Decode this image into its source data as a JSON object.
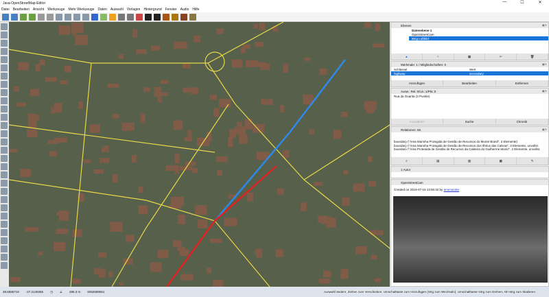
{
  "window": {
    "title": "Java-OpenStreetMap-Editor",
    "controls": [
      "—",
      "☐",
      "✕"
    ]
  },
  "menu": [
    "Datei",
    "Bearbeiten",
    "Ansicht",
    "Werkzeuge",
    "Mehr Werkzeuge",
    "Daten",
    "Auswahl",
    "Vorlagen",
    "Hintergrund",
    "Fenster",
    "Audio",
    "Hilfe"
  ],
  "toolbar_colors": [
    "#4a7fc0",
    "#4a7fc0",
    "#6aa040",
    "#6aa040",
    "#999",
    "#999",
    "#8899aa",
    "#8899aa",
    "#8899aa",
    "#8899aa",
    "#3366cc",
    "#88bb66",
    "#f0a020",
    "#777",
    "#777",
    "#cc4444",
    "#222",
    "#222",
    "#aa5511",
    "#aa7711",
    "#884422",
    "#887744"
  ],
  "layers": {
    "title": "Ebenen",
    "items": [
      {
        "name": "Datenebene 1",
        "bold": true
      },
      {
        "name": "OpenStreetCam"
      },
      {
        "name": "Bing Luftbild",
        "selected": true
      }
    ]
  },
  "tags": {
    "title": "Merkmale: 1 / Mitgliedschaften: 0",
    "col_key": "Schlüssel",
    "col_value": "Wert",
    "rows": [
      {
        "key": "highway",
        "value": "secondary"
      }
    ],
    "add": "Hinzufügen",
    "edit": "Bearbeiten",
    "delete": "Entfernen"
  },
  "selection": {
    "title": "Ausw.: Rel.:0/Lin.:1/Pkt.:0",
    "items": [
      "Rua da Guarita (3 Punkte)"
    ],
    "select": "Auswählen",
    "search": "Suche",
    "history": "Chronik"
  },
  "relations": {
    "title": "Relationen: 56",
    "items": [
      "boundary (\"Área Marinha Protegida de Gestão de Recursos do Monte Brasil\", 2 Elemente)",
      "boundary (\"Área Marinha Protegida de Gestão de Recursos dos Ilhéus das Cabras\", 3 Elemente, unvollst.",
      "boundary (\"Área Protegida de Gestão de Recursos da Caldeira do Guilherme Moniz\", 2 Elemente, unvollst."
    ]
  },
  "authors": {
    "title": "1 Autor"
  },
  "osc": {
    "title": "OpenStreetCam",
    "created_prefix": "Created on 2019-07-16 13:56:32 by",
    "user": "anumazdar"
  },
  "status": {
    "lat": "38.6586719",
    "lon": "-27.2149365",
    "heading": "",
    "angle": "",
    "length": "286.3 m",
    "id": "6092689551",
    "help": "Auswahl ändern; Ziehen zum Verschieben; Umschalttaste zum Hinzufügen (Strg zum Wechseln); Umschalttaste+Strg zum Drehen; Alt+Strg zum Skalieren"
  }
}
